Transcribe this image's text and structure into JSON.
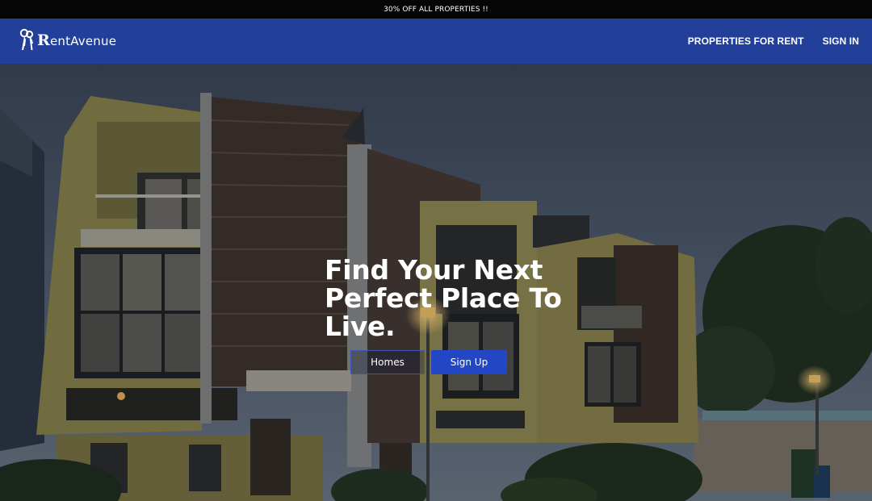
{
  "promo": {
    "text": "30% OFF ALL PROPERTIES !!"
  },
  "nav": {
    "brand_initial": "R",
    "brand_rest": "entAvenue",
    "brand_icon": "keys-icon",
    "links": [
      {
        "label": "PROPERTIES FOR RENT"
      },
      {
        "label": "SIGN IN"
      }
    ]
  },
  "hero": {
    "headline_lines": [
      "Find Your Next",
      "Perfect Place To",
      "Live."
    ],
    "buttons": {
      "homes": "Homes",
      "signup": "Sign Up"
    },
    "background": "townhouse-photo-dusk"
  },
  "colors": {
    "promo_bg": "#050505",
    "nav_bg": "#223f9a",
    "accent": "#2347c4",
    "text": "#ffffff"
  }
}
